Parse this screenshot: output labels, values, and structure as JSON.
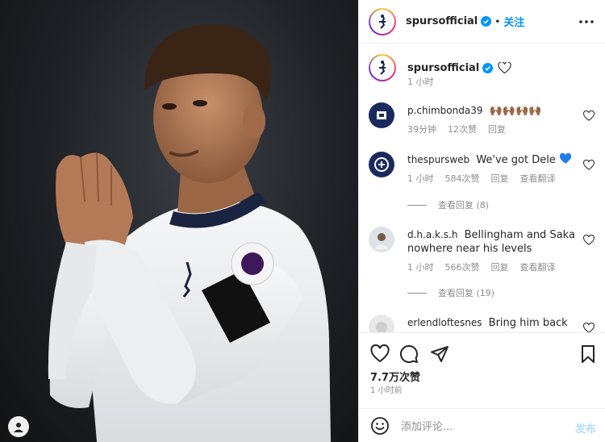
{
  "header": {
    "username": "spursofficial",
    "dot": "•",
    "follow_label": "关注"
  },
  "caption": {
    "username": "spursofficial",
    "time": "1 小时"
  },
  "comments": [
    {
      "username": "p.chimbonda39",
      "text": "",
      "emoji": "🙌🏾🙌🏾🙌🏾🙌🏾",
      "time": "39分钟",
      "likes": "12次赞",
      "reply": "回复",
      "translate": ""
    },
    {
      "username": "thespursweb",
      "text": "We've got Dele",
      "emoji": "💙",
      "time": "1 小时",
      "likes": "584次赞",
      "reply": "回复",
      "translate": "查看翻译",
      "view_replies": "查看回复 (8)"
    },
    {
      "username": "d.h.a.k.s.h",
      "text": "Bellingham and Saka nowhere near his levels",
      "time": "1 小时",
      "likes": "566次赞",
      "reply": "回复",
      "translate": "查看翻译",
      "view_replies": "查看回复 (19)"
    },
    {
      "username": "erlendloftesnes",
      "text": "Bring him back"
    }
  ],
  "actions": {
    "like_count": "7.7万次赞",
    "post_time": "1 小时前"
  },
  "add_comment": {
    "placeholder": "添加评论...",
    "post_label": "发布"
  },
  "icons": {
    "verified": "verified-badge-icon",
    "more": "more-horizontal-icon",
    "like": "heart-icon",
    "comment": "comment-bubble-icon",
    "share": "paper-plane-icon",
    "save": "bookmark-icon",
    "emoji": "smiley-icon"
  },
  "colors": {
    "accent": "#0095f6",
    "secondary_text": "#8e8e8e",
    "post_disabled": "#b2dffc"
  }
}
